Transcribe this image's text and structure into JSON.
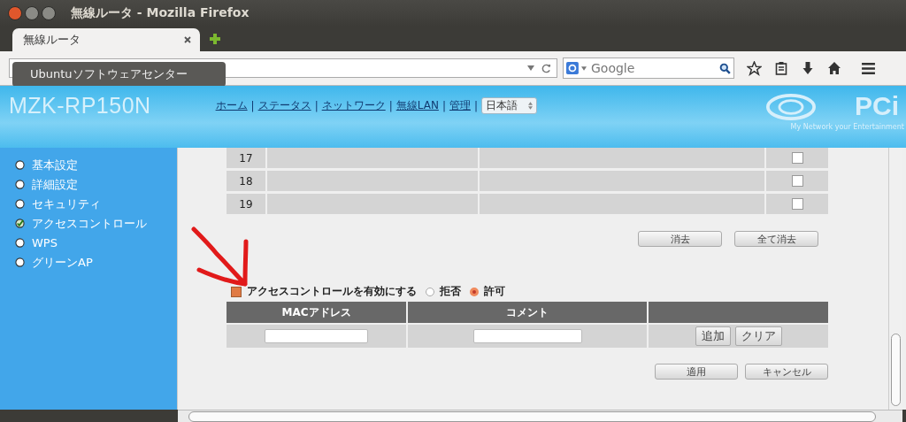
{
  "window": {
    "title": "無線ルータ - Mozilla Firefox"
  },
  "tabs": [
    {
      "label": "無線ルータ",
      "selected": true
    }
  ],
  "search": {
    "placeholder": "Google"
  },
  "tooltip": "Ubuntuソフトウェアセンター",
  "header": {
    "brand": "MZK-RP150N",
    "logo": "PCi",
    "tagline": "My Network your Entertainment",
    "nav": [
      {
        "kind": "link",
        "label": "ホーム"
      },
      {
        "kind": "separator",
        "label": "|"
      },
      {
        "kind": "link",
        "label": "ステータス"
      },
      {
        "kind": "separator",
        "label": "|"
      },
      {
        "kind": "link",
        "label": "ネットワーク"
      },
      {
        "kind": "separator",
        "label": "|"
      },
      {
        "kind": "link",
        "label": "無線LAN"
      },
      {
        "kind": "separator",
        "label": "|"
      },
      {
        "kind": "link",
        "label": "管理"
      },
      {
        "kind": "separator",
        "label": "|"
      }
    ],
    "language": "日本語"
  },
  "sidebar": {
    "items": [
      {
        "label": "基本設定",
        "checked": false
      },
      {
        "label": "詳細設定",
        "checked": false
      },
      {
        "label": "セキュリティ",
        "checked": false
      },
      {
        "label": "アクセスコントロール",
        "checked": true
      },
      {
        "label": "WPS",
        "checked": false
      },
      {
        "label": "グリーンAP",
        "checked": false
      }
    ]
  },
  "list": {
    "rows": [
      {
        "number": "17",
        "checked": false
      },
      {
        "number": "18",
        "checked": false
      },
      {
        "number": "19",
        "checked": false
      }
    ],
    "buttons": [
      "消去",
      "全て消去"
    ]
  },
  "access": {
    "enabled": {
      "label": "アクセスコントロールを有効にする",
      "checked": true
    },
    "modes": [
      {
        "label": "拒否",
        "selected": false
      },
      {
        "label": "許可",
        "selected": true
      }
    ],
    "columns": [
      "MACアドレス",
      "コメント"
    ],
    "row_buttons": [
      "追加",
      "クリア"
    ]
  },
  "buttons": [
    "適用",
    "キャンセル"
  ]
}
